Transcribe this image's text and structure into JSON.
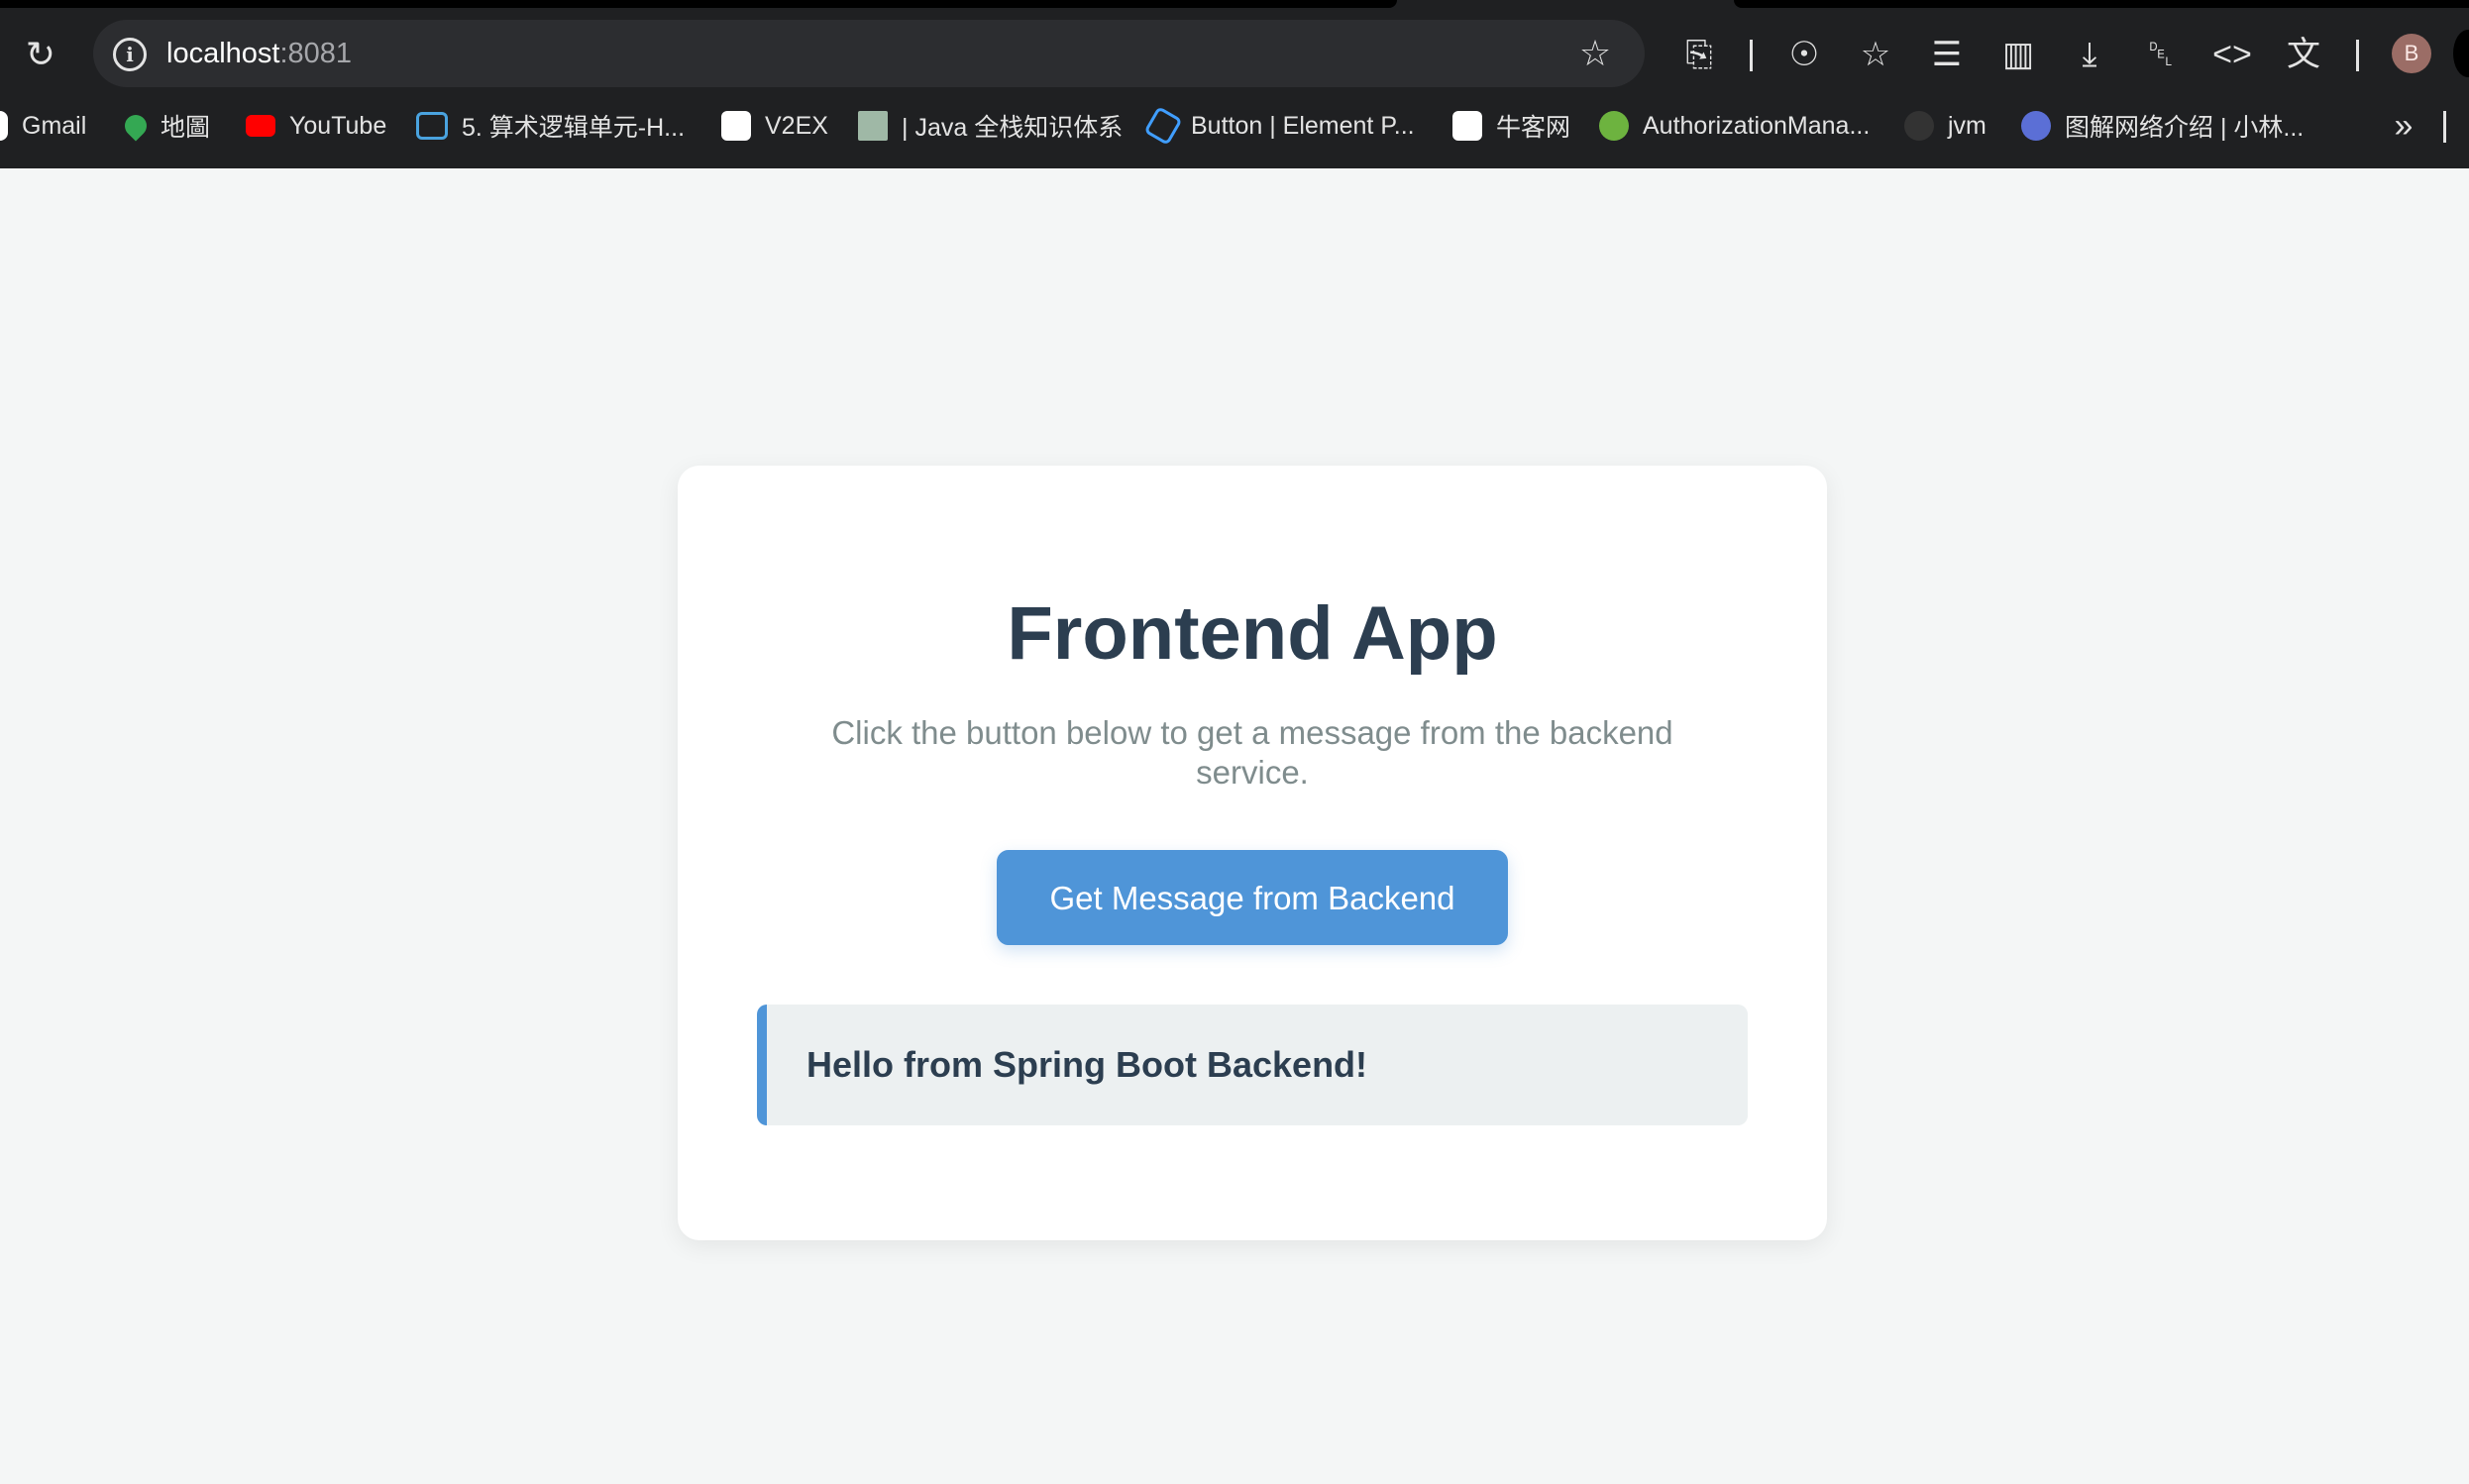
{
  "browser": {
    "url_host": "localhost",
    "url_port": ":8081",
    "avatar_initial": "B",
    "bookmarks": [
      {
        "label": "Gmail",
        "icon": "google-icon",
        "color": "#4285f4"
      },
      {
        "label": "地圖",
        "icon": "maps-pin-icon",
        "color": "#34a853"
      },
      {
        "label": "YouTube",
        "icon": "youtube-icon",
        "color": "#ff0000"
      },
      {
        "label": "5. 算术逻辑单元-H...",
        "icon": "bilibili-icon",
        "color": "#4aa3df"
      },
      {
        "label": "V2EX",
        "icon": "v2ex-icon",
        "color": "#ffffff"
      },
      {
        "label": "| Java 全栈知识体系",
        "icon": "java-site-icon",
        "color": "#9fb8a6"
      },
      {
        "label": "Button | Element P...",
        "icon": "element-icon",
        "color": "#409eff"
      },
      {
        "label": "牛客网",
        "icon": "nowcoder-icon",
        "color": "#ffffff"
      },
      {
        "label": "AuthorizationMana...",
        "icon": "spring-leaf-icon",
        "color": "#6db33f"
      },
      {
        "label": "jvm",
        "icon": "github-icon",
        "color": "#333333"
      },
      {
        "label": "图解网络介绍 | 小林...",
        "icon": "xiaolin-icon",
        "color": "#5b6fd6"
      }
    ]
  },
  "app": {
    "title": "Frontend App",
    "subtitle": "Click the button below to get a message from the backend service.",
    "button_label": "Get Message from Backend",
    "message": "Hello from Spring Boot Backend!",
    "accent_color": "#4f95d8"
  }
}
